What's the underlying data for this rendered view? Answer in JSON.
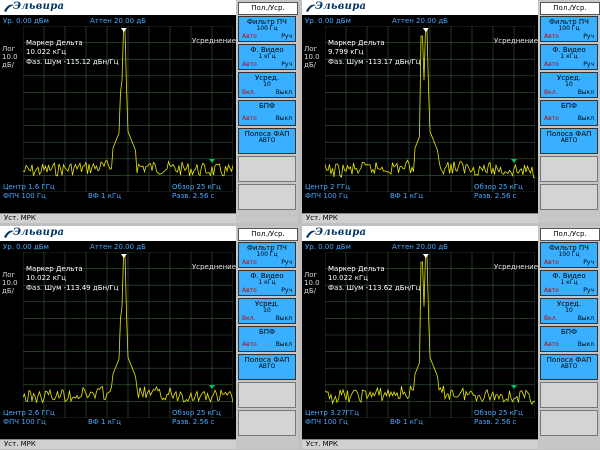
{
  "brand": "Эльвира",
  "ui": {
    "ref_level": "Ур. 0.00 дБм",
    "atten": "Аттен 20.00 дБ",
    "log_label": "Лог",
    "scale": "10.0",
    "scale_unit": "дБ/",
    "averaging": "Усреднение",
    "marker_title": "Маркер Дельта",
    "rbw": "ФПЧ 100 Гц",
    "vbw": "ВФ 1 кГц",
    "span_sweep": "Обзор 25 кГц",
    "sweep_time": "Разв. 2.56 с",
    "status": "Уст. МРК"
  },
  "softkeys": {
    "title": "Пол./Уср.",
    "if_filter": {
      "label": "Фильтр ПЧ",
      "value": "100 Гц",
      "on": "Авто",
      "off": "Руч"
    },
    "video_filter": {
      "label": "Ф. Видео",
      "value": "1 кГц",
      "on": "Авто",
      "off": "Руч"
    },
    "average": {
      "label": "Усред.",
      "value": "10",
      "on": "Вкл.",
      "off": "Выкл"
    },
    "fft": {
      "label": "БПФ",
      "on": "Авто",
      "off": "Выкл"
    },
    "pll_band": {
      "label": "Полоса ФАП",
      "value": "АВТО"
    }
  },
  "panels": [
    {
      "center": "Центр 1.6 ГГц",
      "marker_freq": "10.022 кГц",
      "phase_noise": "Фаз. Шум -115.12 дБн/Гц"
    },
    {
      "center": "Центр 2 ГГц",
      "marker_freq": "9.799 кГц",
      "phase_noise": "Фаз. Шум -113.17 дБн/Гц"
    },
    {
      "center": "Центр 2.6 ГГц",
      "marker_freq": "10.022 кГц",
      "phase_noise": "Фаз. Шум -113.49 дБн/Гц"
    },
    {
      "center": "Центр 3.27ГГц",
      "marker_freq": "10.022 кГц",
      "phase_noise": "Фаз. Шум -113.62 дБн/Гц"
    }
  ],
  "colors": {
    "trace": "#e8e800",
    "grid": "#3a5a3a",
    "softkey": "#38b0ff",
    "screen": "#000000"
  }
}
